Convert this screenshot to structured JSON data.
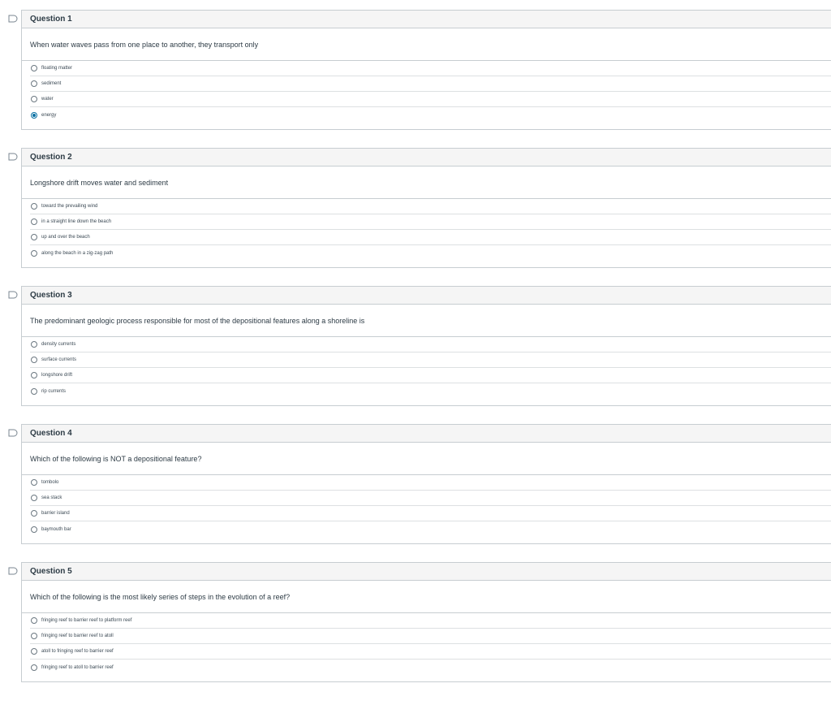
{
  "colors": {
    "accent": "#0770a3",
    "border": "#c7cdd1",
    "header_bg": "#f5f5f5",
    "text": "#2d3b45"
  },
  "icons": {
    "flag": "flag-outline-icon"
  },
  "questions": [
    {
      "title": "Question 1",
      "text": "When water waves pass from one place to another, they transport only",
      "selected": 3,
      "answers": [
        "floating matter",
        "sediment",
        "water",
        "energy"
      ]
    },
    {
      "title": "Question 2",
      "text": "Longshore drift moves water and sediment",
      "selected": null,
      "answers": [
        "toward the prevailing wind",
        "in a straight line down the beach",
        "up and over the beach",
        "along the beach in a zig-zag path"
      ]
    },
    {
      "title": "Question 3",
      "text": "The predominant geologic process responsible for most of the depositional features along a shoreline is",
      "selected": null,
      "answers": [
        "density currents",
        "surface currents",
        "longshore drift",
        "rip currents"
      ]
    },
    {
      "title": "Question 4",
      "text": "Which of the following is NOT a depositional feature?",
      "selected": null,
      "answers": [
        "tombolo",
        "sea stack",
        "barrier island",
        "baymouth bar"
      ]
    },
    {
      "title": "Question 5",
      "text": "Which of the following is the most likely series of steps in the evolution of a reef?",
      "selected": null,
      "answers": [
        "fringing reef to barrier reef to platform reef",
        "fringing reef to barrier reef to atoll",
        "atoll to fringing reef to barrier reef",
        "fringing reef to atoll to barrier reef"
      ]
    }
  ]
}
